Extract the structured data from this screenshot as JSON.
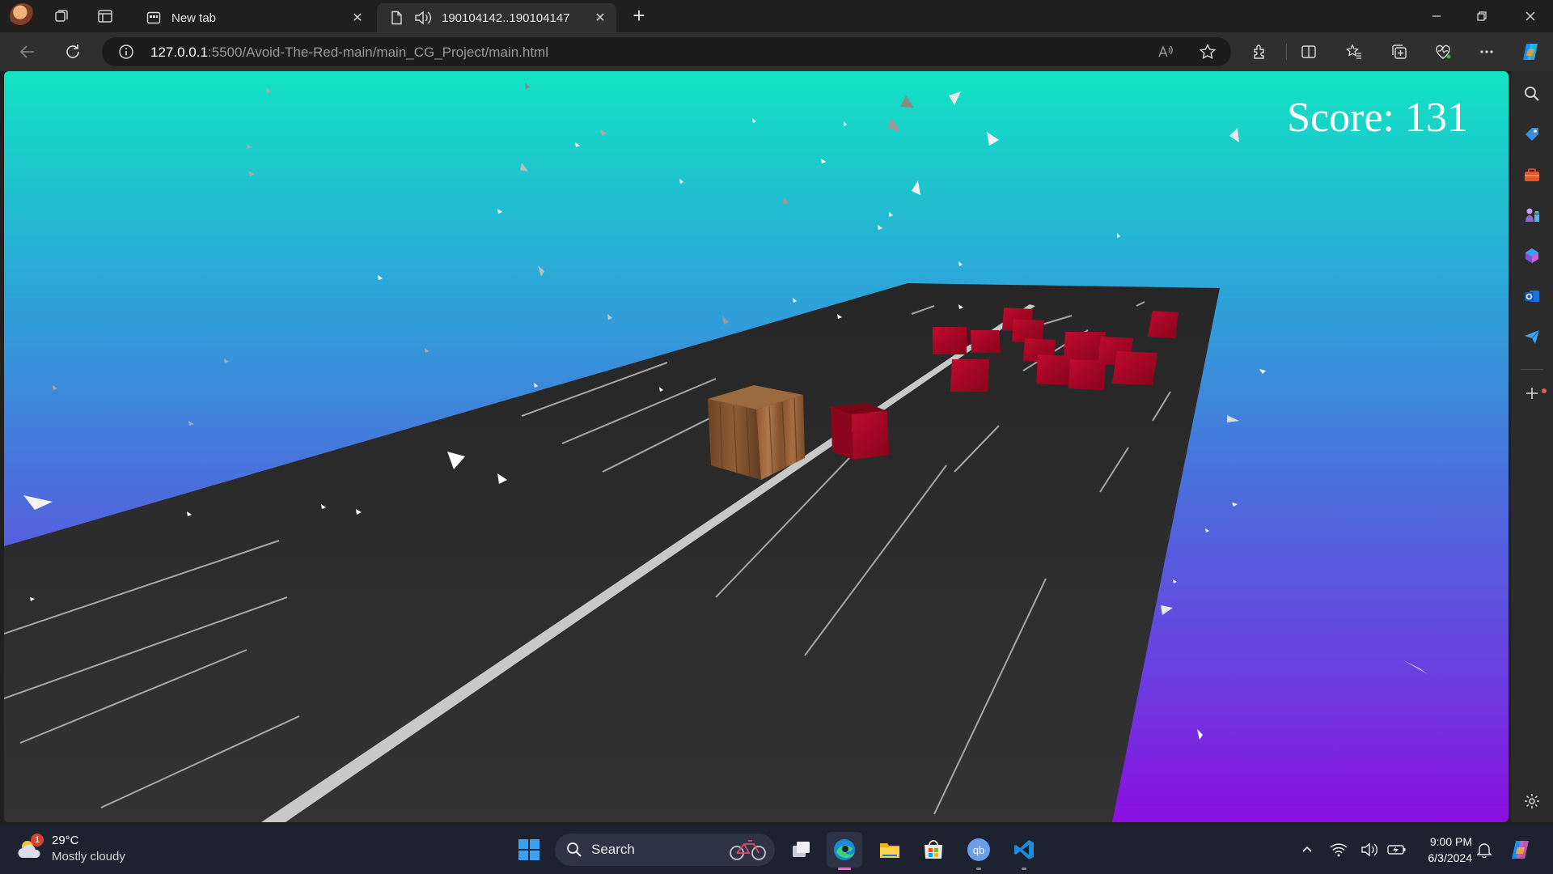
{
  "browser": {
    "tabs": [
      {
        "label": "New tab",
        "icon": "new-tab-page-icon",
        "active": false
      },
      {
        "label": "190104142..190104147",
        "icon": "document-icon",
        "active": true,
        "audio": true
      }
    ],
    "address": {
      "host": "127.0.0.1",
      "path": ":5500/Avoid-The-Red-main/main_CG_Project/main.html"
    }
  },
  "game": {
    "score_label": "Score: 131",
    "colors": {
      "sky_top": "#12e3c3",
      "sky_bottom": "#8a0fe0",
      "road": "#2e2e2e",
      "red_cube": "#b00828",
      "player_cube": "#8b5a32"
    }
  },
  "taskbar": {
    "weather": {
      "temp": "29°C",
      "desc": "Mostly cloudy",
      "badge": "1"
    },
    "search_label": "Search",
    "time": "9:00 PM",
    "date": "6/3/2024"
  }
}
